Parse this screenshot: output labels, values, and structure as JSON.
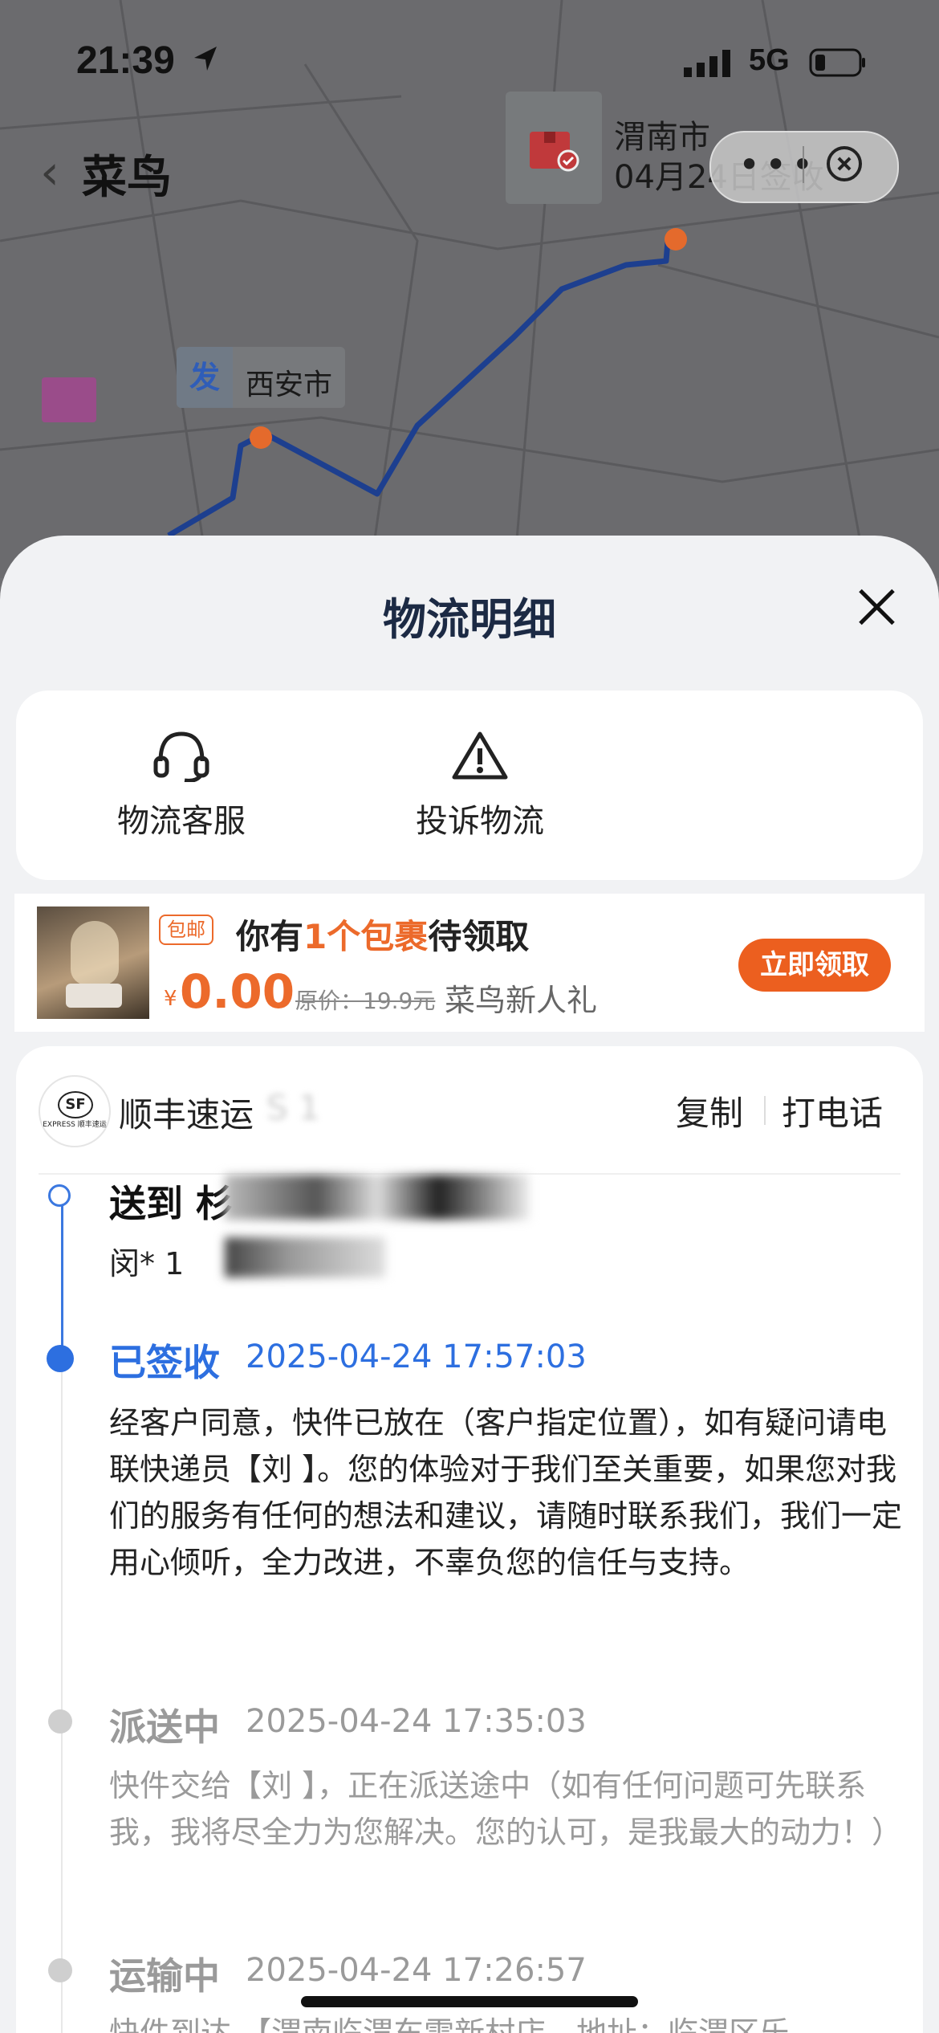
{
  "status_bar": {
    "time": "21:39",
    "network": "5G"
  },
  "map": {
    "app_title": "菜鸟",
    "destination": {
      "city": "渭南市",
      "date_status": "04月24日签收"
    },
    "origin": {
      "badge": "发",
      "city": "西安市"
    },
    "capsule": {
      "more": "•••"
    },
    "route_color": "#1d3f8f"
  },
  "sheet": {
    "title": "物流明细",
    "actions": [
      {
        "label": "物流客服",
        "icon": "headset-icon"
      },
      {
        "label": "投诉物流",
        "icon": "warning-icon"
      }
    ],
    "promo": {
      "tag": "包邮",
      "title_pre": "你有",
      "title_highlight": "1个包裹",
      "title_post": "待领取",
      "yen": "¥",
      "price": "0.00",
      "original_price": "原价：19.9元",
      "gift_label": "菜鸟新人礼",
      "button": "立即领取"
    },
    "tracking": {
      "carrier_name": "顺丰速运",
      "carrier_logo": "SF",
      "carrier_logo_en": "EXPRESS 顺丰速运",
      "tracking_number_masked": "S 1",
      "copy": "复制",
      "call": "打电话",
      "send_to_prefix": "送到 杉",
      "recipient": "闵* 1",
      "events": [
        {
          "status": "已签收",
          "time": "2025-04-24 17:57:03",
          "description": "经客户同意，快件已放在（客户指定位置），如有疑问请电联快递员【刘 】。您的体验对于我们至关重要，如果您对我们的服务有任何的想法和建议，请随时联系我们，我们一定用心倾听，全力改进，不辜负您的信任与支持。"
        },
        {
          "status": "派送中",
          "time": "2025-04-24 17:35:03",
          "description": "快件交给【刘 】，正在派送途中（如有任何问题可先联系我，我将尽全力为您解决。您的认可，是我最大的动力！）"
        },
        {
          "status": "运输中",
          "time": "2025-04-24 17:26:57",
          "description": "快件到达 【渭南临渭车雷新村店，地址：临渭区乐"
        }
      ]
    },
    "colors": {
      "accent_blue": "#2d6fe0",
      "promo_orange": "#ec5f1f"
    }
  }
}
